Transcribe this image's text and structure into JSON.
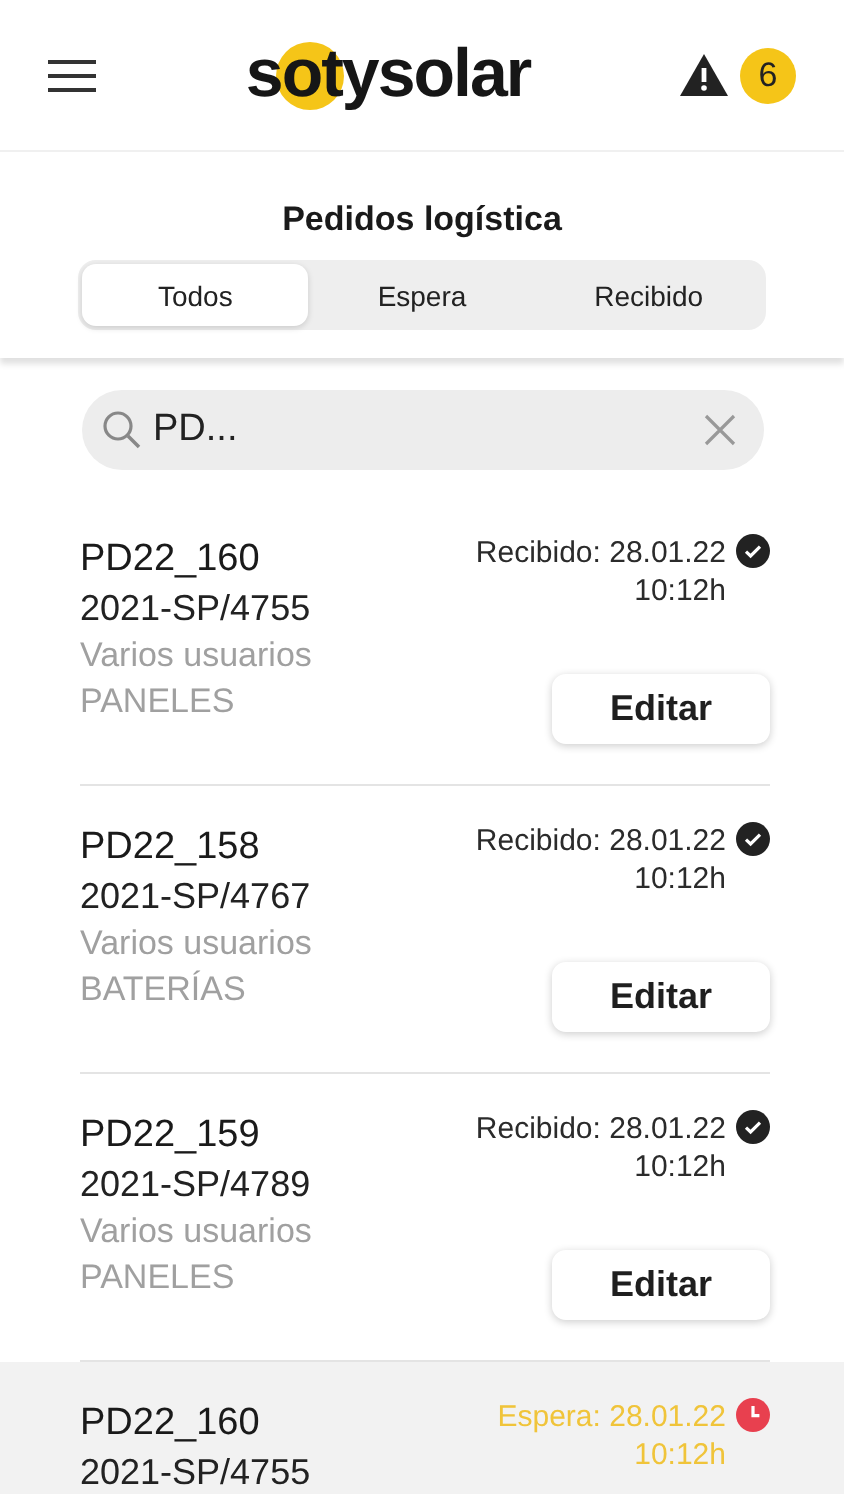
{
  "header": {
    "logo": "sotysolar",
    "alert_count": "6"
  },
  "title": "Pedidos logística",
  "tabs": [
    {
      "label": "Todos",
      "selected": true
    },
    {
      "label": "Espera",
      "selected": false
    },
    {
      "label": "Recibido",
      "selected": false
    }
  ],
  "search": {
    "value": "PD..."
  },
  "orders": [
    {
      "code": "PD22_160",
      "ref": "2021-SP/4755",
      "users": "Varios usuarios",
      "category": "PANELES",
      "kind": "recibido",
      "date": "Recibido: 28.01.22",
      "time": "10:12h",
      "button": "Editar",
      "selected": false
    },
    {
      "code": "PD22_158",
      "ref": "2021-SP/4767",
      "users": "Varios usuarios",
      "category": "BATERÍAS",
      "kind": "recibido",
      "date": "Recibido: 28.01.22",
      "time": "10:12h",
      "button": "Editar",
      "selected": false
    },
    {
      "code": "PD22_159",
      "ref": "2021-SP/4789",
      "users": "Varios usuarios",
      "category": "PANELES",
      "kind": "recibido",
      "date": "Recibido: 28.01.22",
      "time": "10:12h",
      "button": "Editar",
      "selected": false
    },
    {
      "code": "PD22_160",
      "ref": "2021-SP/4755",
      "kind": "espera",
      "date": "Espera: 28.01.22",
      "time": "10:12h",
      "selected": true
    }
  ]
}
